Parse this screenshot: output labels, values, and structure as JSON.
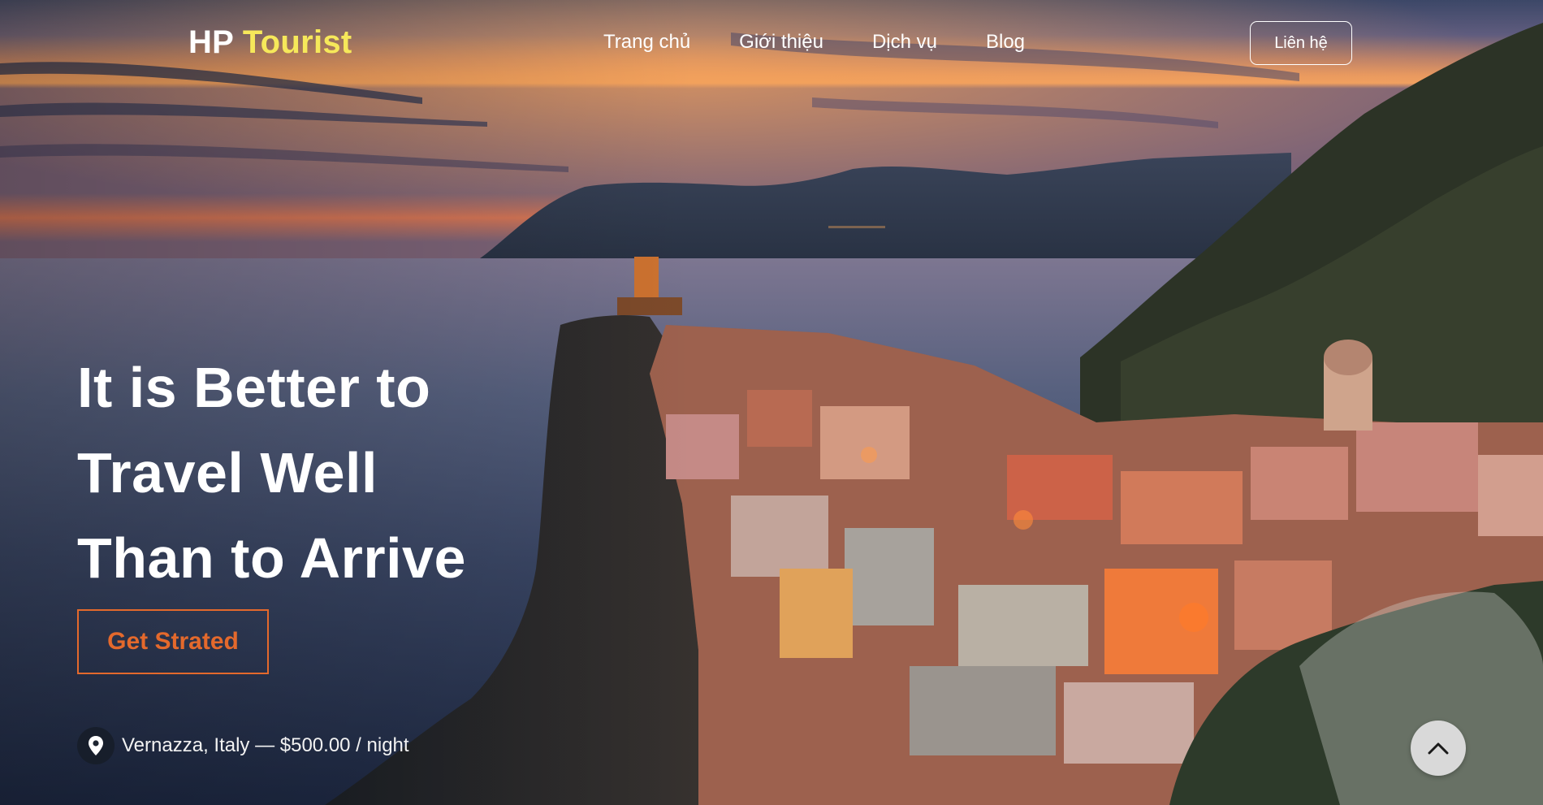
{
  "header": {
    "logo_primary": "HP",
    "logo_accent": "Tourist",
    "nav": [
      {
        "label": "Trang chủ"
      },
      {
        "label": "Giới thiệu"
      },
      {
        "label": "Dịch vụ"
      },
      {
        "label": "Blog"
      }
    ],
    "contact_label": "Liên hệ"
  },
  "hero": {
    "headline_lines": [
      "It is Better to",
      "Travel Well",
      "Than to Arrive"
    ],
    "cta_label": "Get Strated",
    "location_icon": "map-pin-icon",
    "location_text": "Vernazza, Italy — $500.00 / night"
  },
  "scroll_top": {
    "icon": "chevron-up-icon"
  },
  "colors": {
    "logo_accent": "#f6e85a",
    "cta_accent": "#e4692c",
    "text": "#ffffff",
    "scroll_button": "#d9d9d9"
  }
}
